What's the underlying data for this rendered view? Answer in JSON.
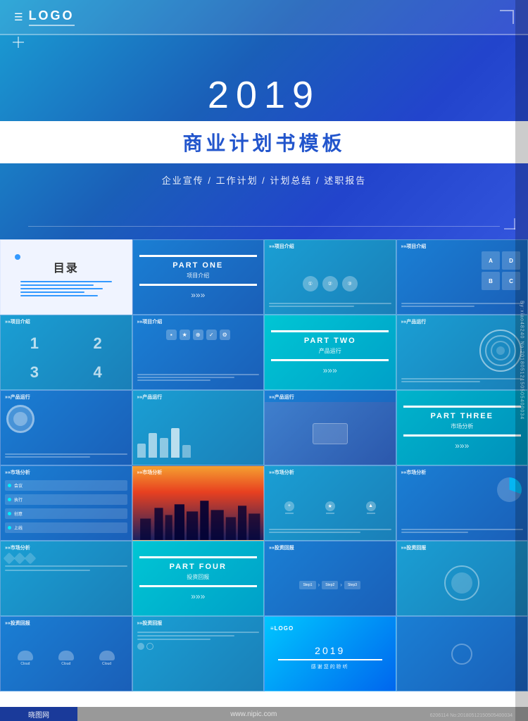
{
  "header": {
    "logo_text": "LOGO",
    "year": "2019",
    "title_cn": "商业计划书模板",
    "subtitle": "企业宣传 / 工作计划 / 计划总结 / 述职报告"
  },
  "slides": {
    "row1": [
      {
        "type": "toc",
        "label": "目录"
      },
      {
        "type": "part",
        "part": "PART ONE",
        "cn": "项目介绍"
      },
      {
        "type": "content",
        "label": ">>项目介绍"
      },
      {
        "type": "content",
        "label": ">>项目介绍"
      }
    ],
    "row2": [
      {
        "type": "content",
        "label": ">>项目介绍"
      },
      {
        "type": "content",
        "label": ">>项目介绍"
      },
      {
        "type": "part",
        "part": "PART TWO",
        "cn": "产品运行"
      },
      {
        "type": "content",
        "label": ">>产品运行"
      }
    ],
    "row3": [
      {
        "type": "content",
        "label": ">>产品运行"
      },
      {
        "type": "content",
        "label": ">>产品运行"
      },
      {
        "type": "content",
        "label": ">>产品运行"
      },
      {
        "type": "part",
        "part": "PART THREE",
        "cn": "市场分析"
      }
    ],
    "row4": [
      {
        "type": "content",
        "label": ">>市场分析"
      },
      {
        "type": "photo_city",
        "label": ">>市场分析"
      },
      {
        "type": "content",
        "label": ">>市场分析"
      },
      {
        "type": "content",
        "label": ">>市场分析"
      }
    ],
    "row5": [
      {
        "type": "content",
        "label": ">>市场分析"
      },
      {
        "type": "part",
        "part": "PART FOUR",
        "cn": "投资回报"
      },
      {
        "type": "content",
        "label": ">>投资回报"
      },
      {
        "type": "content",
        "label": ">>投资回报"
      }
    ],
    "row6": [
      {
        "type": "content",
        "label": ">>投资回报"
      },
      {
        "type": "content",
        "label": ">>投资回报"
      },
      {
        "type": "thankyou",
        "year": "2019",
        "cn": "感谢您的聆听"
      },
      {
        "type": "blank"
      }
    ]
  },
  "watermark": {
    "side_text": "By:xiao48240 No:20180512150505400034",
    "id_text": "6206114 No:20180512150505400034",
    "nipic_url": "www.nipic.com",
    "xiaomao": "晓图网"
  }
}
